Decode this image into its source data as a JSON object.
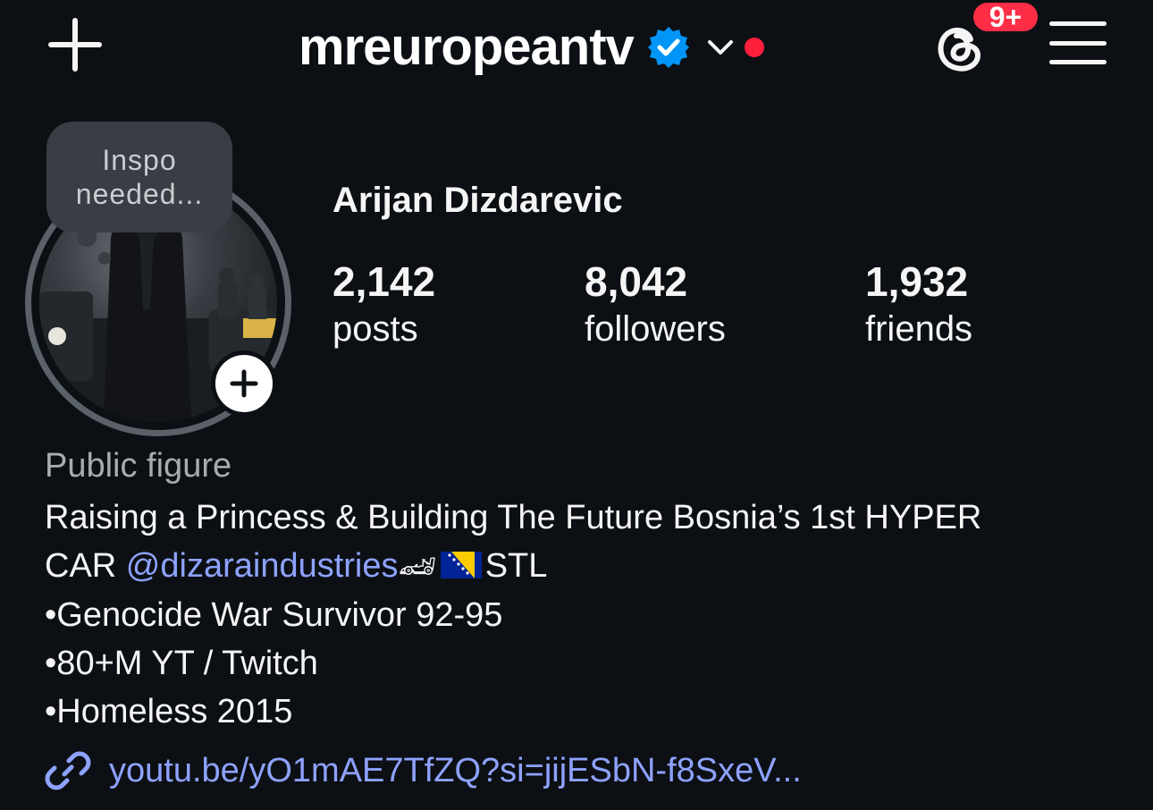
{
  "header": {
    "username": "mreuropeantv",
    "notification_badge": "9+",
    "icons": {
      "create": "plus-icon",
      "verified": "verified-badge-icon",
      "account_switch": "chevron-down-icon",
      "threads": "threads-icon",
      "menu": "hamburger-menu-icon"
    },
    "colors": {
      "verified": "#0095f6",
      "notification": "#ff2d46",
      "link": "#8ea2ff"
    }
  },
  "note": {
    "line1": "Inspo",
    "line2": "needed..."
  },
  "profile": {
    "full_name": "Arijan Dizdarevic",
    "stats": [
      {
        "count": "2,142",
        "label": "posts"
      },
      {
        "count": "8,042",
        "label": "followers"
      },
      {
        "count": "1,932",
        "label": "friends"
      }
    ]
  },
  "bio": {
    "category": "Public figure",
    "line1": "Raising a Princess & Building The Future Bosnia’s 1st HYPER",
    "line2_prefix": "CAR ",
    "mention": "@dizaraindustries",
    "race_car_emoji": "🏎",
    "flag_name": "Bosnia and Herzegovina flag",
    "line2_suffix": "STL",
    "line3": "•Genocide War Survivor 92-95",
    "line4": "•80+M YT / Twitch",
    "line5": "•Homeless 2015",
    "link": "youtu.be/yO1mAE7TfZQ?si=jijESbN-f8SxeV..."
  }
}
